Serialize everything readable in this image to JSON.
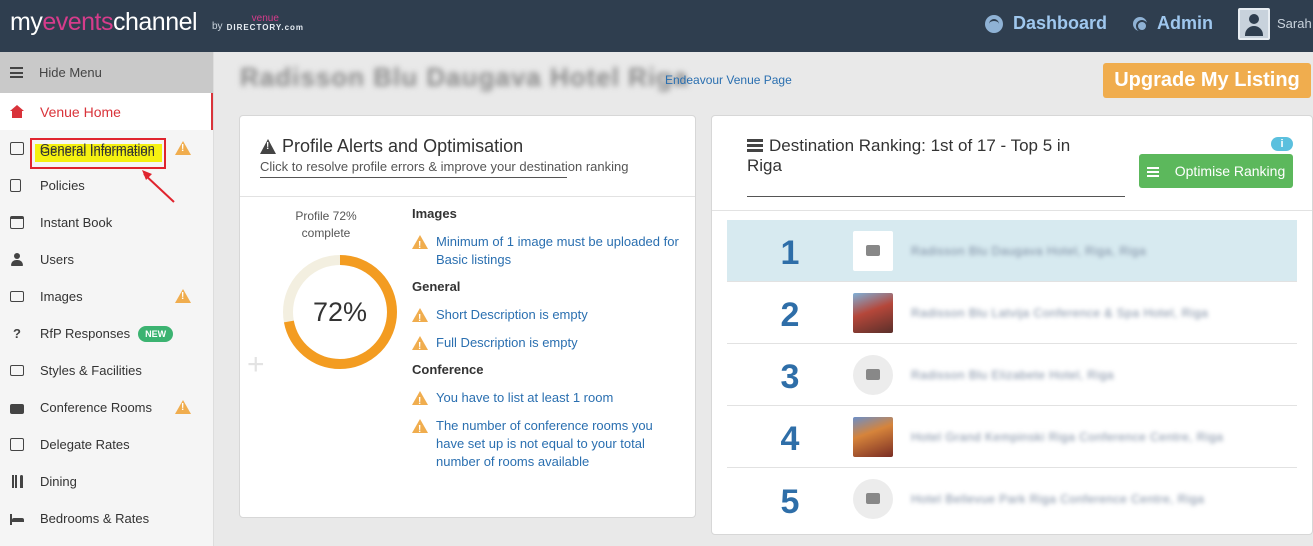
{
  "header": {
    "logo": {
      "part1": "my",
      "part2": "events",
      "part3": "channel",
      "by": "by",
      "venue": "venue",
      "directory": "DIRECTORY.com"
    },
    "nav": {
      "dashboard": "Dashboard",
      "admin": "Admin"
    },
    "user": "Sarah"
  },
  "sidebar": {
    "hide_menu": "Hide Menu",
    "items": [
      {
        "label": "Venue Home",
        "icon": "home-icon",
        "active": true,
        "warning": false
      },
      {
        "label": "General Information",
        "icon": "edit-icon",
        "warning": true
      },
      {
        "label": "Policies",
        "icon": "document-icon",
        "warning": false
      },
      {
        "label": "Instant Book",
        "icon": "calendar-icon",
        "warning": false
      },
      {
        "label": "Users",
        "icon": "user-icon",
        "warning": false
      },
      {
        "label": "Images",
        "icon": "image-icon",
        "warning": true
      },
      {
        "label": "RfP Responses",
        "icon": "question-icon",
        "badge": "NEW"
      },
      {
        "label": "Styles & Facilities",
        "icon": "monitor-icon",
        "warning": false
      },
      {
        "label": "Conference Rooms",
        "icon": "briefcase-icon",
        "warning": true
      },
      {
        "label": "Delegate Rates",
        "icon": "calculator-icon",
        "warning": false
      },
      {
        "label": "Dining",
        "icon": "cutlery-icon",
        "warning": false
      },
      {
        "label": "Bedrooms & Rates",
        "icon": "bed-icon",
        "warning": false
      }
    ]
  },
  "main": {
    "venue_title": "Radisson Blu Daugava Hotel Riga",
    "venue_link": "Endeavour Venue Page",
    "upgrade_button": "Upgrade My Listing"
  },
  "profile": {
    "title": "Profile Alerts and Optimisation",
    "subtitle": "Click to resolve profile errors & improve your destination ranking",
    "complete_label": "Profile 72% complete",
    "percent_text": "72%",
    "percent": 72,
    "groups": [
      {
        "heading": "Images",
        "alerts": [
          "Minimum of 1 image must be uploaded for Basic listings"
        ]
      },
      {
        "heading": "General",
        "alerts": [
          "Short Description is empty",
          "Full Description is empty"
        ]
      },
      {
        "heading": "Conference",
        "alerts": [
          "You have to list at least 1 room",
          "The number of conference rooms you have set up is not equal to your total number of rooms available"
        ]
      }
    ]
  },
  "ranking": {
    "title": "Destination Ranking: 1st of 17 - Top 5 in Riga",
    "info_badge": "i",
    "optimise_button": "Optimise Ranking",
    "rows": [
      {
        "rank": "1",
        "name": "Radisson Blu Daugava Hotel, Riga, Riga",
        "thumb": "placeholder"
      },
      {
        "rank": "2",
        "name": "Radisson Blu Latvija Conference & Spa Hotel, Riga",
        "thumb": "photo"
      },
      {
        "rank": "3",
        "name": "Radisson Blu Elizabete Hotel, Riga",
        "thumb": "placeholder"
      },
      {
        "rank": "4",
        "name": "Hotel Grand Kempinski Riga Conference Centre, Riga",
        "thumb": "photo"
      },
      {
        "rank": "5",
        "name": "Hotel Bellevue Park Riga Conference Centre, Riga",
        "thumb": "placeholder"
      }
    ]
  },
  "colors": {
    "header_bg": "#2f3e4f",
    "accent_red": "#d9333a",
    "warning": "#f0ad4e",
    "link_blue": "#2a6fb0",
    "success": "#5cb85c",
    "donut_fill": "#f39c21",
    "rank_highlight": "#d7eaf0"
  }
}
